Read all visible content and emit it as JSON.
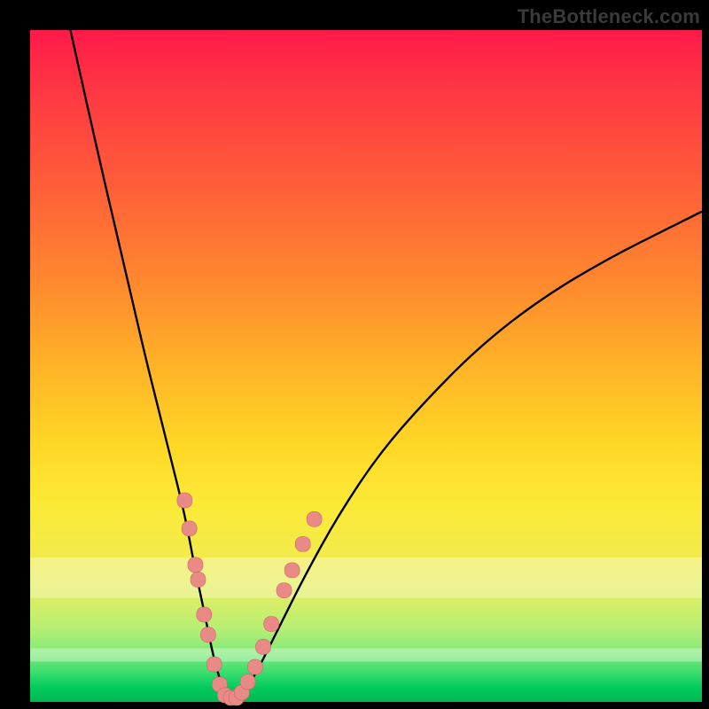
{
  "watermark": "TheBottleneck.com",
  "colors": {
    "frame": "#000000",
    "curve": "#000000",
    "marker_fill": "#e98a86",
    "marker_stroke": "#c96a68"
  },
  "chart_data": {
    "type": "line",
    "title": "",
    "xlabel": "",
    "ylabel": "",
    "xlim": [
      0,
      100
    ],
    "ylim": [
      0,
      100
    ],
    "grid": false,
    "legend": false,
    "series": [
      {
        "name": "bottleneck-curve",
        "x": [
          6,
          10,
          14,
          17,
          19,
          21,
          23,
          24.5,
          26,
          27,
          28,
          29,
          30,
          32,
          34,
          37,
          41,
          46,
          52,
          59,
          67,
          76,
          86,
          96,
          100
        ],
        "y": [
          100,
          82,
          65,
          52,
          44,
          36,
          28,
          20,
          13,
          8,
          4,
          1.5,
          0.5,
          1.5,
          5,
          11,
          19,
          28,
          37,
          45,
          53,
          60,
          66,
          71,
          73
        ]
      }
    ],
    "markers": [
      {
        "x": 23.0,
        "y": 30.0
      },
      {
        "x": 23.7,
        "y": 25.8
      },
      {
        "x": 24.6,
        "y": 20.4
      },
      {
        "x": 25.0,
        "y": 18.2
      },
      {
        "x": 25.9,
        "y": 13.0
      },
      {
        "x": 26.5,
        "y": 10.0
      },
      {
        "x": 27.4,
        "y": 5.6
      },
      {
        "x": 28.2,
        "y": 2.6
      },
      {
        "x": 29.0,
        "y": 1.0
      },
      {
        "x": 29.9,
        "y": 0.6
      },
      {
        "x": 30.7,
        "y": 0.6
      },
      {
        "x": 31.5,
        "y": 1.4
      },
      {
        "x": 32.4,
        "y": 3.0
      },
      {
        "x": 33.5,
        "y": 5.2
      },
      {
        "x": 34.7,
        "y": 8.2
      },
      {
        "x": 35.9,
        "y": 11.6
      },
      {
        "x": 37.8,
        "y": 16.6
      },
      {
        "x": 39.0,
        "y": 19.6
      },
      {
        "x": 40.6,
        "y": 23.5
      },
      {
        "x": 42.3,
        "y": 27.2
      }
    ],
    "pale_bands_y": [
      {
        "from": 15.5,
        "to": 21.5
      },
      {
        "from": 6.0,
        "to": 8.0
      }
    ]
  }
}
